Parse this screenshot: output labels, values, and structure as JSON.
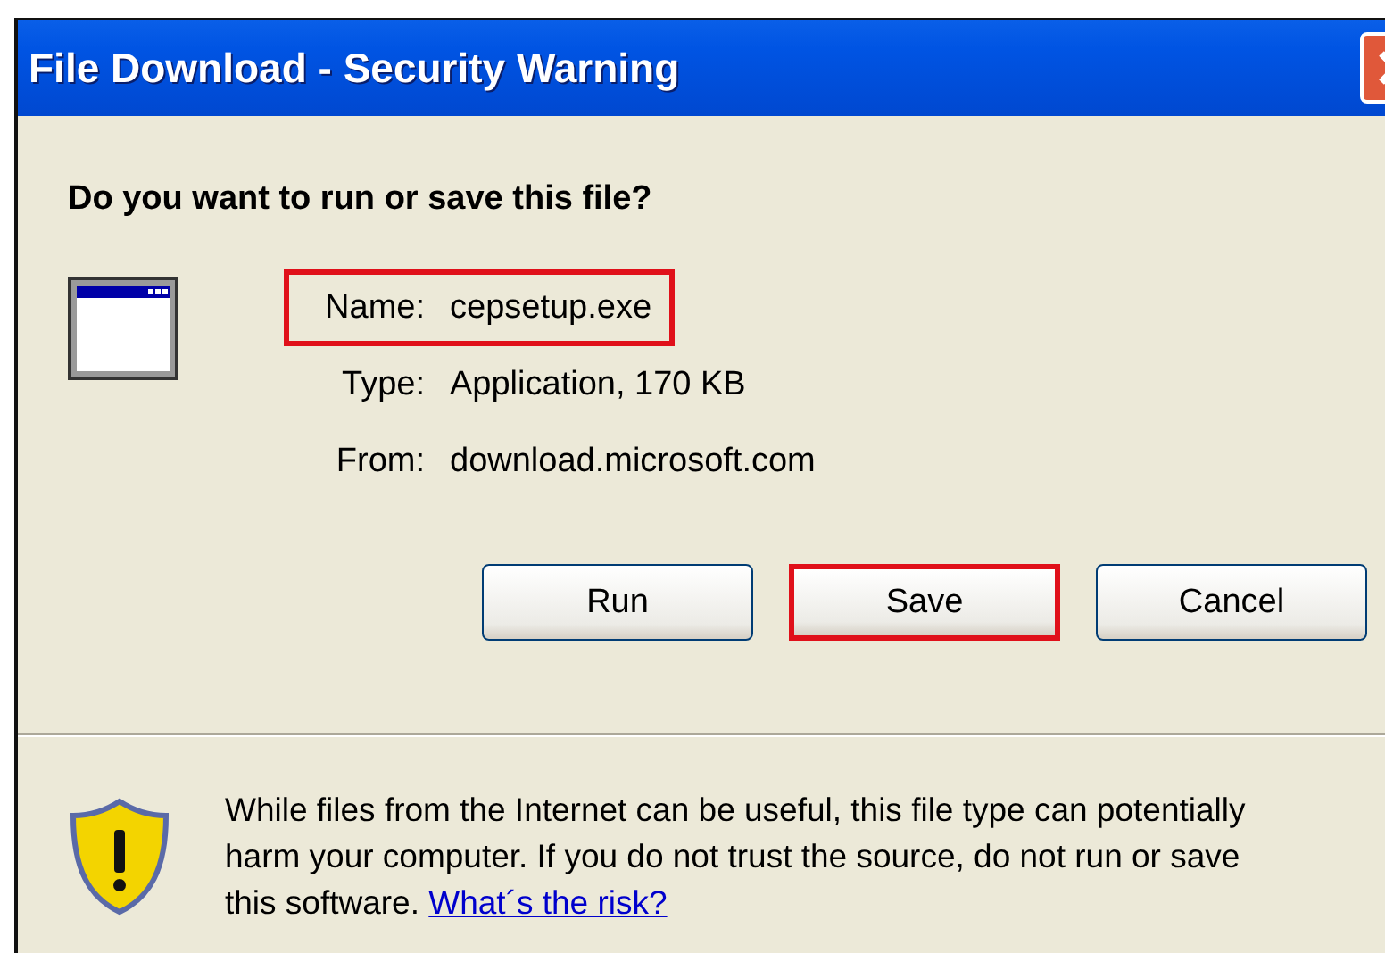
{
  "window": {
    "title": "File Download - Security Warning"
  },
  "question": "Do you want to run or save this file?",
  "file_info": [
    {
      "label": "Name:",
      "value": "cepsetup.exe",
      "highlighted": true
    },
    {
      "label": "Type:",
      "value": "Application, 170 KB",
      "highlighted": false
    },
    {
      "label": "From:",
      "value": "download.microsoft.com",
      "highlighted": false
    }
  ],
  "buttons": [
    {
      "label": "Run",
      "highlighted": false
    },
    {
      "label": "Save",
      "highlighted": true
    },
    {
      "label": "Cancel",
      "highlighted": false
    }
  ],
  "warning": {
    "text": "While files from the Internet can be useful, this file type can potentially harm your computer. If you do not trust the source, do not run or save this software.",
    "link": "What´s the risk?"
  }
}
